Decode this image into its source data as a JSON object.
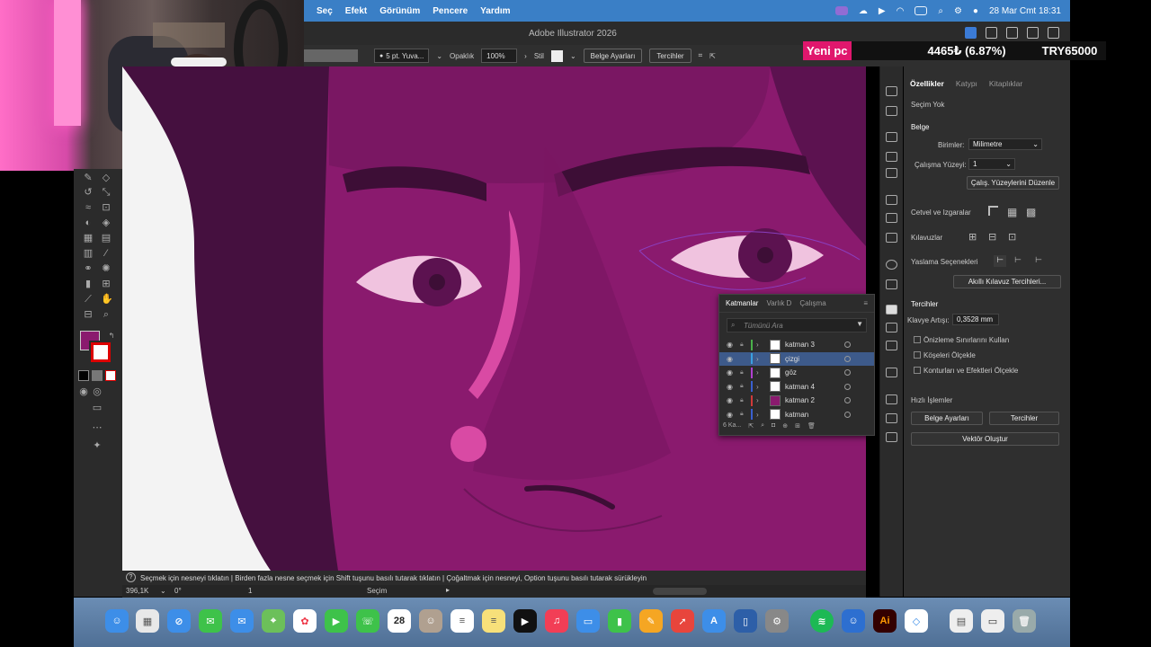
{
  "menubar": {
    "items": [
      "Seç",
      "Efekt",
      "Görünüm",
      "Pencere",
      "Yardım"
    ],
    "datetime": "28 Mar Cmt  18:31"
  },
  "window": {
    "title": "Adobe Illustrator 2026"
  },
  "controlbar": {
    "stroke": "5 pt. Yuva...",
    "opacity_label": "Opaklık",
    "opacity_value": "100%",
    "style_label": "Stil",
    "doc_settings": "Belge Ayarları",
    "preferences": "Tercihler"
  },
  "ticker": {
    "tag": "Yeni pc",
    "value": "4465₺ (6.87%)",
    "goal": "TRY65000"
  },
  "layers_panel": {
    "tabs": [
      "Katmanlar",
      "Varlık D",
      "Çalışma"
    ],
    "search_placeholder": "Tümünü Ara",
    "layers": [
      {
        "name": "katman 3",
        "color": "#4ab04a",
        "selected": false
      },
      {
        "name": "çizgi",
        "color": "#3aa0e0",
        "selected": true
      },
      {
        "name": "göz",
        "color": "#b040d0",
        "selected": false
      },
      {
        "name": "katman 4",
        "color": "#3a60d0",
        "selected": false
      },
      {
        "name": "katman 2",
        "color": "#d03a3a",
        "selected": false
      },
      {
        "name": "katman",
        "color": "#3a60d0",
        "selected": false
      }
    ],
    "footer_count": "6 Ka..."
  },
  "properties": {
    "tabs": [
      "Özellikler",
      "Katypı",
      "Kitaplıklar"
    ],
    "selection": "Seçim Yok",
    "document_header": "Belge",
    "units_label": "Birimler:",
    "units_value": "Milimetre",
    "artboard_label": "Çalışma Yüzeyi:",
    "artboard_value": "1",
    "edit_artboards": "Çalış. Yüzeylerini Düzenle",
    "rulers_grids": "Cetvel ve Izgaralar",
    "guides": "Kılavuzlar",
    "snap_options": "Yaslama Seçenekleri",
    "smart_guide_prefs": "Akıllı Kılavuz Tercihleri...",
    "preferences_header": "Tercihler",
    "keyboard_inc_label": "Klavye Artışı:",
    "keyboard_inc_value": "0,3528 mm",
    "cb_preview_bounds": "Önizleme Sınırlarını Kullan",
    "cb_scale_corners": "Köşeleri Ölçekle",
    "cb_scale_strokes": "Konturları ve Efektleri Ölçekle",
    "quick_actions": "Hızlı İşlemler",
    "btn_doc_settings": "Belge Ayarları",
    "btn_preferences": "Tercihler",
    "btn_vectorize": "Vektör Oluştur"
  },
  "statusbar": {
    "hint": "Seçmek için nesneyi tıklatın  |  Birden fazla nesne seçmek için Shift tuşunu basılı tutarak tıklatın  |  Çoğaltmak için nesneyi, Option tuşunu basılı tutarak sürükleyin",
    "zoom": "396,1K",
    "rotation": "0°",
    "artboard_num": "1",
    "tool_name": "Seçim"
  },
  "dock": {
    "calendar_day": "28",
    "ai_label": "Ai",
    "apps": [
      "Finder",
      "Launchpad",
      "Safari",
      "Messages",
      "Mail",
      "Maps",
      "Photos",
      "FaceTime",
      "Phone",
      "Calendar",
      "Contacts",
      "Reminders",
      "Notes",
      "TV",
      "Music",
      "Keynote",
      "Numbers",
      "Pages",
      "Rocket",
      "App Store",
      "Preview",
      "Settings",
      "Spotify",
      "Finder2",
      "Illustrator",
      "Proxy",
      "Doc",
      "Window",
      "Trash"
    ]
  },
  "colors": {
    "menubar": "#3a7fc6",
    "artwork_bg": "#8a1a6e",
    "accent_pink": "#e0176d"
  }
}
